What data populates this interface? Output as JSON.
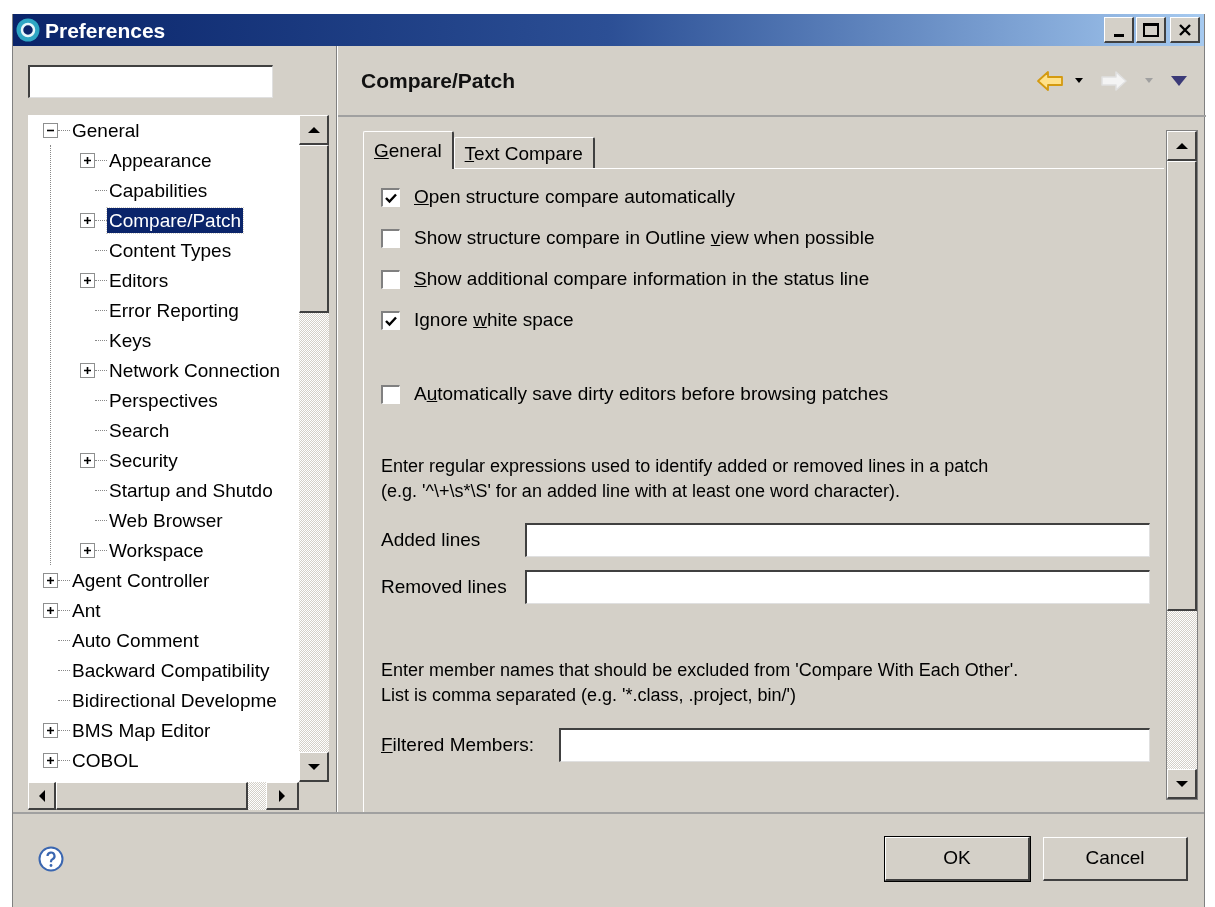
{
  "window": {
    "title": "Preferences"
  },
  "tree": [
    {
      "label": "General",
      "expanded": true,
      "selected": false,
      "children": [
        {
          "label": "Appearance",
          "expanded": false,
          "selected": false
        },
        {
          "label": "Capabilities",
          "selected": false
        },
        {
          "label": "Compare/Patch",
          "expanded": false,
          "selected": true
        },
        {
          "label": "Content Types",
          "selected": false
        },
        {
          "label": "Editors",
          "expanded": false,
          "selected": false
        },
        {
          "label": "Error Reporting",
          "selected": false
        },
        {
          "label": "Keys",
          "selected": false
        },
        {
          "label": "Network Connection",
          "expanded": false,
          "selected": false
        },
        {
          "label": "Perspectives",
          "selected": false
        },
        {
          "label": "Search",
          "selected": false
        },
        {
          "label": "Security",
          "expanded": false,
          "selected": false
        },
        {
          "label": "Startup and Shutdo",
          "selected": false
        },
        {
          "label": "Web Browser",
          "selected": false
        },
        {
          "label": "Workspace",
          "expanded": false,
          "selected": false
        }
      ]
    },
    {
      "label": "Agent Controller",
      "expanded": false,
      "selected": false
    },
    {
      "label": "Ant",
      "expanded": false,
      "selected": false
    },
    {
      "label": "Auto Comment",
      "selected": false
    },
    {
      "label": "Backward Compatibility",
      "selected": false
    },
    {
      "label": "Bidirectional Developme",
      "selected": false
    },
    {
      "label": "BMS Map Editor",
      "expanded": false,
      "selected": false
    },
    {
      "label": "COBOL",
      "expanded": false,
      "selected": false
    }
  ],
  "page": {
    "title": "Compare/Patch",
    "tabs": [
      {
        "label": {
          "key": "G",
          "after": "eneral"
        },
        "selected": true
      },
      {
        "label": {
          "key": "T",
          "after": "ext Compare"
        },
        "selected": false
      }
    ],
    "options": [
      {
        "label": {
          "key": "O",
          "after": "pen structure compare automatically"
        },
        "checked": true
      },
      {
        "label": {
          "before": "Show structure compare in Outline ",
          "key": "v",
          "after": "iew when possible"
        },
        "checked": false
      },
      {
        "label": {
          "key": "S",
          "after": "how additional compare information in the status line"
        },
        "checked": false
      },
      {
        "label": {
          "before": "Ignore ",
          "key": "w",
          "after": "hite space"
        },
        "checked": true
      }
    ],
    "patch_options": [
      {
        "label": {
          "before": "A",
          "key": "u",
          "after": "tomatically save dirty editors before browsing patches"
        },
        "checked": false
      }
    ],
    "regex_help": [
      "Enter regular expressions used to identify added or removed lines in a patch",
      "(e.g. '^\\+\\s*\\S' for an added line with at least one word character)."
    ],
    "regex_fields": [
      {
        "label": "Added lines"
      },
      {
        "label": "Removed lines"
      }
    ],
    "filter_help": [
      "Enter member names that should be excluded from 'Compare With Each Other'.",
      "List is comma separated (e.g. '*.class, .project, bin/')"
    ],
    "filter_field": {
      "label": {
        "key": "F",
        "after": "iltered Members:"
      }
    }
  },
  "buttons": [
    {
      "label": "OK",
      "default": true
    },
    {
      "label": "Cancel",
      "default": false
    }
  ]
}
